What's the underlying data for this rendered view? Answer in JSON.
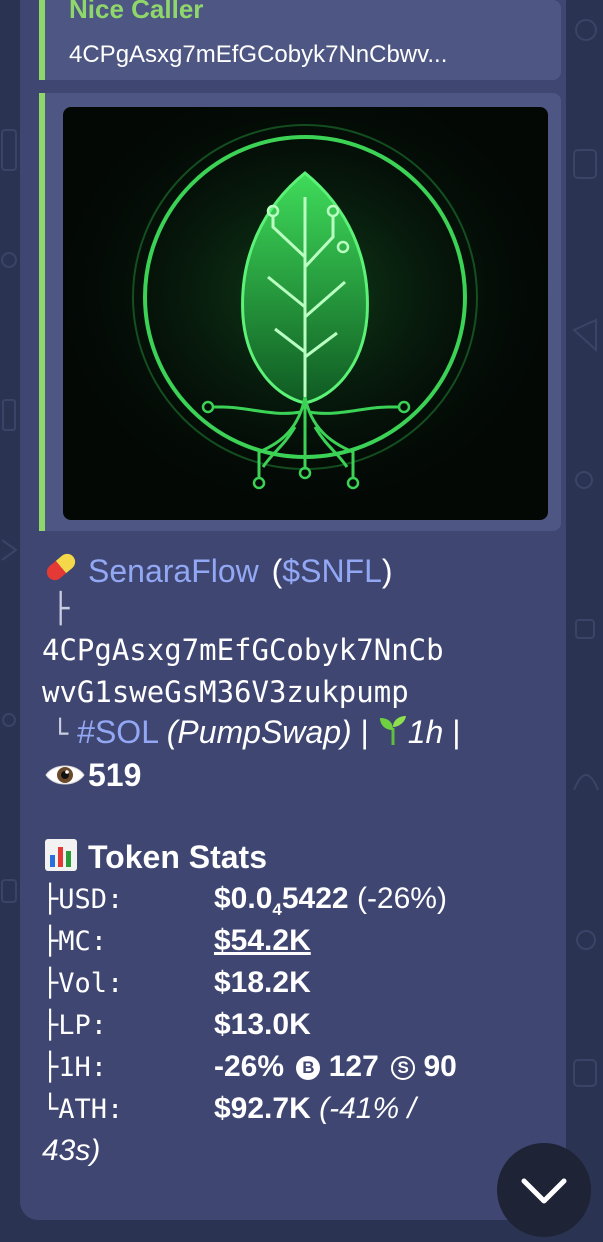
{
  "reply": {
    "name": "Nice Caller",
    "preview": "4CPgAsxg7mEfGCobyk7NnCbwv..."
  },
  "token": {
    "icon": "pill-emoji",
    "name": "SenaraFlow",
    "open_paren": "(",
    "ticker": "$SNFL",
    "close_paren": ")",
    "branch_char": "├",
    "address_line1": "4CPgAsxg7mEfGCobyk7NnCb",
    "address_line2": "wvG1sweGsM36V3zukpump",
    "end_branch": "└",
    "chain": "#SOL",
    "dex": "(PumpSwap)",
    "separator": "|",
    "age": "1h",
    "age_icon": "seedling-emoji",
    "views_icon": "eye-emoji",
    "views": "519"
  },
  "stats": {
    "icon": "bar-chart-emoji",
    "title": "Token Stats",
    "usd_label": "├USD:",
    "usd_value_prefix": "$0.0",
    "usd_value_sub": "4",
    "usd_value_suffix": "5422",
    "usd_change": "(-26%)",
    "mc_label": "├MC:",
    "mc_value": "$54.2K",
    "vol_label": "├Vol:",
    "vol_value": "$18.2K",
    "lp_label": "├LP:",
    "lp_value": "$13.0K",
    "h1_label": "├1H:",
    "h1_change": "-26%",
    "buys_letter": "B",
    "buys": "127",
    "sells_letter": "S",
    "sells": "90",
    "ath_label": "└ATH:",
    "ath_value": "$92.7K",
    "ath_change_line1": "(-41% /",
    "ath_change_line2": "43s)"
  },
  "colors": {
    "background": "#2b3352",
    "bubble": "#3f4672",
    "accent_green": "#8fd76a",
    "link_blue": "#93a8f4"
  },
  "scroll_button": {
    "icon": "chevron-down-icon"
  }
}
